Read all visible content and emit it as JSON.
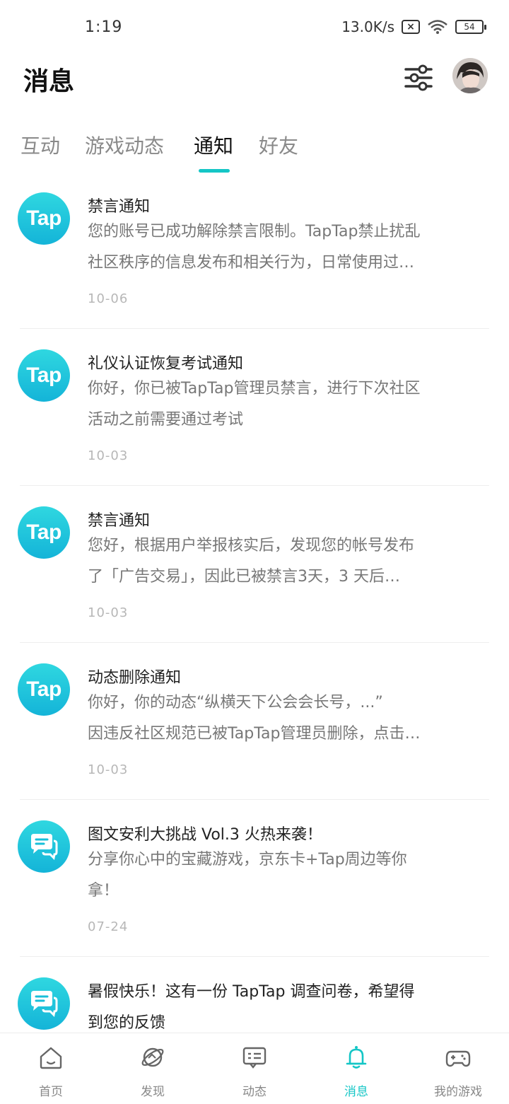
{
  "status_bar": {
    "time": "1:19",
    "network_speed": "13.0K/s",
    "battery": "54",
    "icons": [
      "sim-blocked-icon",
      "wifi-icon",
      "battery-icon"
    ]
  },
  "header": {
    "title": "消息",
    "filter_icon": "filter-sliders-icon"
  },
  "tabs": [
    {
      "label": "互动"
    },
    {
      "label": "游戏动态"
    },
    {
      "label": "通知"
    },
    {
      "label": "好友"
    }
  ],
  "active_tab": "通知",
  "notifications": [
    {
      "icon": "Tap",
      "title": "禁言通知",
      "line1": "您的账号已成功解除禁言限制。TapTap禁止扰乱",
      "line2": "社区秩序的信息发布和相关行为，日常使用过…",
      "date": "10-06"
    },
    {
      "icon": "Tap",
      "title": "礼仪认证恢复考试通知",
      "line1": "你好，你已被TapTap管理员禁言，进行下次社区",
      "line2": "活动之前需要通过考试",
      "date": "10-03"
    },
    {
      "icon": "Tap",
      "title": "禁言通知",
      "line1": "您好，根据用户举报核实后，发现您的帐号发布",
      "line2": "了「广告交易」，因此已被禁言3天，3 天后…",
      "date": "10-03"
    },
    {
      "icon": "Tap",
      "title": "动态删除通知",
      "line1": "你好，你的动态“纵横天下公会会长号，...”",
      "line2": "因违反社区规范已被TapTap管理员删除，点击…",
      "date": "10-03"
    },
    {
      "icon": "chat-bubble-icon",
      "title": "图文安利大挑战 Vol.3 火热来袭！",
      "line1": "分享你心中的宝藏游戏，京东卡+Tap周边等你",
      "line2": "拿！",
      "date": "07-24"
    },
    {
      "icon": "chat-bubble-icon",
      "title": "暑假快乐！这有一份 TapTap 调查问卷，希望得",
      "line1": "到您的反馈",
      "line2": "",
      "date": ""
    }
  ],
  "bottom_nav": [
    {
      "label": "首页",
      "icon": "home-icon"
    },
    {
      "label": "发现",
      "icon": "planet-icon"
    },
    {
      "label": "动态",
      "icon": "feed-icon"
    },
    {
      "label": "消息",
      "icon": "bell-icon"
    },
    {
      "label": "我的游戏",
      "icon": "gamepad-icon"
    }
  ],
  "colors": {
    "accent": "#14c6c6",
    "text_primary": "#222222",
    "text_secondary": "#777777",
    "date": "#b7b7b7"
  }
}
